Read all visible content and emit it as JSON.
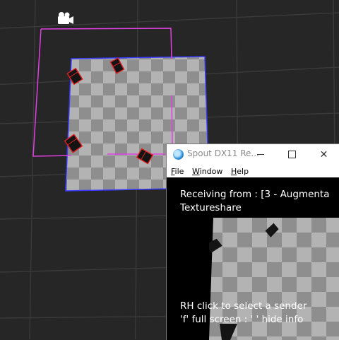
{
  "scene": {
    "camera_icon": "camera-icon",
    "colors": {
      "background": "#262626",
      "grid_line": "#3a3a3a",
      "selection_outline": "#e040e0",
      "plane_outline": "#3a3aff",
      "checker_light": "#b3b3b3",
      "checker_dark": "#8e8e8e"
    }
  },
  "spout_window": {
    "title": "Spout DX11 Re...",
    "app_icon": "spout-icon",
    "minimize_icon": "minimize-icon",
    "maximize_icon": "maximize-icon",
    "close_icon": "close-icon",
    "close_glyph": "✕",
    "menu": {
      "file": {
        "hotkey": "F",
        "rest": "ile"
      },
      "window": {
        "hotkey": "W",
        "rest": "indow"
      },
      "help": {
        "hotkey": "H",
        "rest": "elp"
      }
    },
    "receiving_label": "Receiving from : [3 - Augmenta",
    "sender_name": "Textureshare",
    "hint_select": "RH click to select  a sender",
    "hint_keys": "'f' full screen  :  ' ' hide info"
  }
}
